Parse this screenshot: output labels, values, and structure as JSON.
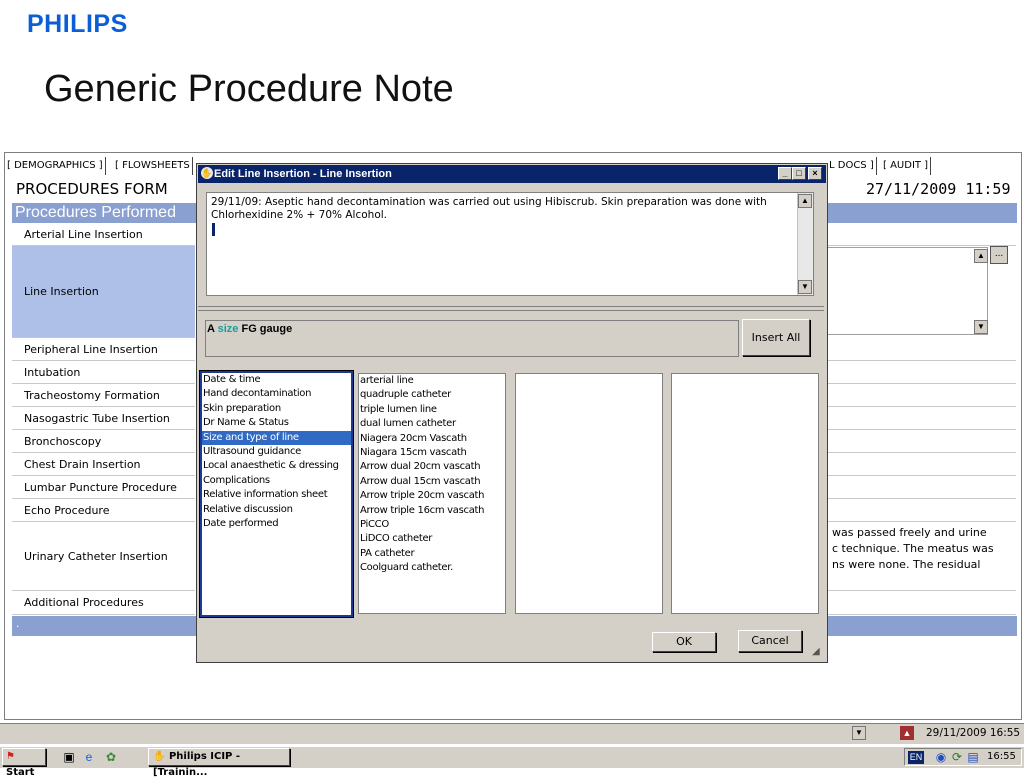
{
  "slide": {
    "brand": "PHILIPS",
    "title": "Generic Procedure Note"
  },
  "tabs": [
    "[ DEMOGRAPHICS ]",
    "[ FLOWSHEETS",
    "L DOCS ]",
    "[ AUDIT ]"
  ],
  "form": {
    "title": "PROCEDURES FORM",
    "datetime": "27/11/2009 11:59",
    "section_header": "Procedures Performed",
    "footer_marker": ".",
    "procedures": [
      "Arterial Line Insertion",
      "Line Insertion",
      "Peripheral Line Insertion",
      "Intubation",
      "Tracheostomy Formation",
      "Nasogastric Tube Insertion",
      "Bronchoscopy",
      "Chest Drain Insertion",
      "Lumbar Puncture Procedure",
      "Echo Procedure",
      "Urinary Catheter Insertion",
      "Additional Procedures"
    ],
    "urine_note_lines": [
      "was passed freely and urine",
      "c technique. The meatus was",
      "ns were none. The residual"
    ],
    "more_button": "..."
  },
  "dialog": {
    "title": "Edit Line Insertion - Line Insertion",
    "note_text": "29/11/09: Aseptic hand decontamination was carried out using Hibiscrub. Skin preparation was done with Chlorhexidine 2% + 70% Alcohol.",
    "template": {
      "prefix": "A",
      "highlight": "size",
      "suffix": "FG gauge"
    },
    "insert_all": "Insert All",
    "ok": "OK",
    "cancel": "Cancel",
    "categories": [
      "Date & time",
      "Hand decontamination",
      "Skin preparation",
      "Dr Name & Status",
      "Size and type of line",
      "Ultrasound guidance",
      "Local anaesthetic & dressing",
      "Complications",
      "Relative information sheet",
      "Relative discussion",
      "Date performed"
    ],
    "selected_category": 4,
    "options": [
      "arterial line",
      "quadruple catheter",
      "triple lumen line",
      "dual lumen catheter",
      "Niagera 20cm Vascath",
      "Niagara 15cm vascath",
      "Arrow dual 20cm vascath",
      "Arrow dual 15cm vascath",
      "Arrow triple 20cm vascath",
      "Arrow triple 16cm vascath",
      "PiCCO",
      "LiDCO catheter",
      "PA catheter",
      "Coolguard catheter."
    ]
  },
  "status": {
    "datetime": "29/11/2009 16:55"
  },
  "taskbar": {
    "start": "Start",
    "task": "Philips ICIP - [Trainin...",
    "lang": "EN",
    "time": "16:55"
  }
}
